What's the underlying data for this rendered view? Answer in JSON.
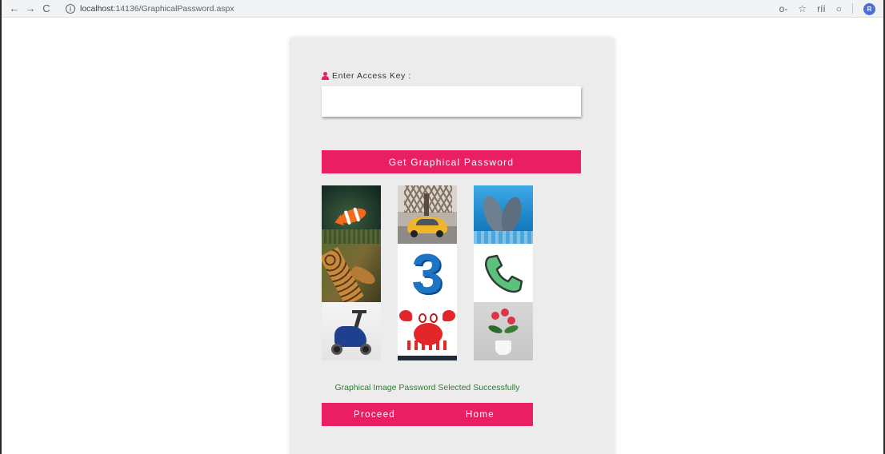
{
  "browser": {
    "back_icon": "←",
    "forward_icon": "→",
    "reload_icon": "C",
    "info_icon": "i",
    "url_host": "localhost",
    "url_rest": ":14136/GraphicalPassword.aspx",
    "key_icon": "o-",
    "star_icon": "☆",
    "extension_icon": "ríí",
    "record_icon": "○",
    "avatar_initial": "R"
  },
  "form": {
    "access_key_label": "Enter Access Key :",
    "access_key_value": "",
    "get_password_label": "Get Graphical Password",
    "three_digit": "3"
  },
  "status_message": "Graphical Image Password Selected Successfully",
  "actions": {
    "proceed_label": "Proceed",
    "home_label": "Home"
  },
  "colors": {
    "accent": "#e91e63",
    "success_text": "#2e7d32",
    "card_bg": "#ececec"
  }
}
